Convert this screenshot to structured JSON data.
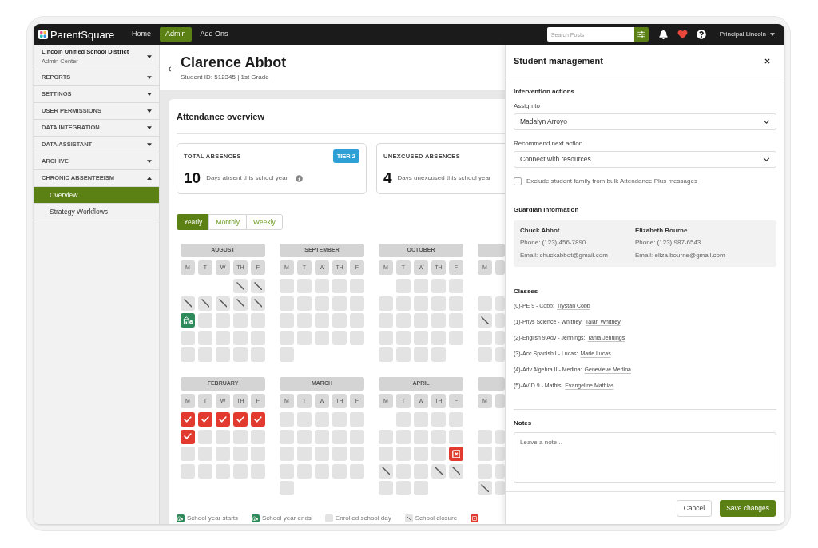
{
  "top_bar": {
    "logo": "ParentSquare",
    "nav": [
      {
        "label": "Home",
        "selected": false
      },
      {
        "label": "Admin",
        "selected": true
      },
      {
        "label": "Add Ons",
        "selected": false
      }
    ],
    "search": {
      "placeholder": "Search Posts"
    },
    "user": "Principal Lincoln"
  },
  "sidebar": {
    "org": {
      "name": "Lincoln Unified School District",
      "subtitle": "Admin Center"
    },
    "sections": [
      {
        "label": "REPORTS",
        "expanded": false
      },
      {
        "label": "SETTINGS",
        "expanded": false
      },
      {
        "label": "USER PERMISSIONS",
        "expanded": false
      },
      {
        "label": "DATA INTEGRATION",
        "expanded": false
      },
      {
        "label": "DATA ASSISTANT",
        "expanded": false
      },
      {
        "label": "ARCHIVE",
        "expanded": false
      },
      {
        "label": "CHRONIC ABSENTEEISM",
        "expanded": true,
        "children": [
          {
            "label": "Overview",
            "selected": true
          },
          {
            "label": "Strategy Workflows",
            "selected": false
          }
        ]
      }
    ]
  },
  "student": {
    "name": "Clarence Abbot",
    "subtitle": "Student ID: 512345 | 1st Grade"
  },
  "attendance": {
    "title": "Attendance overview",
    "stats": [
      {
        "label": "TOTAL ABSENCES",
        "badge": "TIER 2",
        "value": "10",
        "caption": "Days absent this school year",
        "info": true
      },
      {
        "label": "UNEXCUSED ABSENCES",
        "value": "4",
        "caption": "Days unexcused this school year"
      }
    ],
    "views": [
      {
        "label": "Yearly",
        "selected": true
      },
      {
        "label": "Monthly",
        "selected": false
      },
      {
        "label": "Weekly",
        "selected": false
      }
    ],
    "months": [
      {
        "name": "AUGUST",
        "weekdays": [
          "M",
          "T",
          "W",
          "TH",
          "F"
        ],
        "weeks": [
          [
            {
              "kind": "blank"
            },
            {
              "kind": "blank"
            },
            {
              "kind": "blank"
            },
            {
              "kind": "closure"
            },
            {
              "kind": "closure"
            }
          ],
          [
            {
              "kind": "closure"
            },
            {
              "kind": "closure"
            },
            {
              "kind": "closure"
            },
            {
              "kind": "closure"
            },
            {
              "kind": "closure"
            }
          ],
          [
            {
              "kind": "start"
            },
            {
              "kind": "day"
            },
            {
              "kind": "day"
            },
            {
              "kind": "day"
            },
            {
              "kind": "day"
            }
          ],
          [
            {
              "kind": "day"
            },
            {
              "kind": "day"
            },
            {
              "kind": "day"
            },
            {
              "kind": "day"
            },
            {
              "kind": "day"
            }
          ],
          [
            {
              "kind": "day"
            },
            {
              "kind": "day"
            },
            {
              "kind": "day"
            },
            {
              "kind": "day"
            },
            {
              "kind": "day"
            }
          ]
        ]
      },
      {
        "name": "SEPTEMBER",
        "weekdays": [
          "M",
          "T",
          "W",
          "TH",
          "F"
        ],
        "weeks": [
          [
            {
              "kind": "day"
            },
            {
              "kind": "day"
            },
            {
              "kind": "day"
            },
            {
              "kind": "day"
            },
            {
              "kind": "day"
            }
          ],
          [
            {
              "kind": "day"
            },
            {
              "kind": "day"
            },
            {
              "kind": "day"
            },
            {
              "kind": "day"
            },
            {
              "kind": "day"
            }
          ],
          [
            {
              "kind": "day"
            },
            {
              "kind": "day"
            },
            {
              "kind": "day"
            },
            {
              "kind": "day"
            },
            {
              "kind": "day"
            }
          ],
          [
            {
              "kind": "day"
            },
            {
              "kind": "day"
            },
            {
              "kind": "day"
            },
            {
              "kind": "day"
            },
            {
              "kind": "day"
            }
          ],
          [
            {
              "kind": "day"
            }
          ]
        ]
      },
      {
        "name": "OCTOBER",
        "weekdays": [
          "M",
          "T",
          "W",
          "TH",
          "F"
        ],
        "weeks": [
          [
            {
              "kind": "blank"
            },
            {
              "kind": "day"
            },
            {
              "kind": "day"
            },
            {
              "kind": "day"
            },
            {
              "kind": "day"
            }
          ],
          [
            {
              "kind": "day"
            },
            {
              "kind": "day"
            },
            {
              "kind": "day"
            },
            {
              "kind": "day"
            },
            {
              "kind": "day"
            }
          ],
          [
            {
              "kind": "day"
            },
            {
              "kind": "day"
            },
            {
              "kind": "day"
            },
            {
              "kind": "day"
            },
            {
              "kind": "day"
            }
          ],
          [
            {
              "kind": "day"
            },
            {
              "kind": "day"
            },
            {
              "kind": "day"
            },
            {
              "kind": "day"
            },
            {
              "kind": "day"
            }
          ],
          [
            {
              "kind": "day"
            },
            {
              "kind": "day"
            },
            {
              "kind": "day"
            },
            {
              "kind": "day"
            }
          ]
        ]
      },
      {
        "weekdays": [
          "M"
        ],
        "weeks": [
          [
            {
              "kind": "blank"
            },
            {
              "kind": "blank"
            }
          ],
          [
            {
              "kind": "day"
            },
            {
              "kind": "day"
            }
          ],
          [
            {
              "kind": "closure"
            },
            {
              "kind": "day"
            }
          ],
          [
            {
              "kind": "day"
            },
            {
              "kind": "day"
            }
          ],
          [
            {
              "kind": "day"
            },
            {
              "kind": "day"
            }
          ]
        ]
      },
      {
        "name": "FEBRUARY",
        "weekdays": [
          "M",
          "T",
          "W",
          "TH",
          "F"
        ],
        "weeks": [
          [
            {
              "kind": "absent"
            },
            {
              "kind": "absent"
            },
            {
              "kind": "absent"
            },
            {
              "kind": "absent"
            },
            {
              "kind": "absent"
            }
          ],
          [
            {
              "kind": "absent"
            },
            {
              "kind": "day"
            },
            {
              "kind": "day"
            },
            {
              "kind": "day"
            },
            {
              "kind": "day"
            }
          ],
          [
            {
              "kind": "day"
            },
            {
              "kind": "day"
            },
            {
              "kind": "day"
            },
            {
              "kind": "day"
            },
            {
              "kind": "day"
            }
          ],
          [
            {
              "kind": "day"
            },
            {
              "kind": "day"
            },
            {
              "kind": "day"
            },
            {
              "kind": "day"
            },
            {
              "kind": "day"
            }
          ]
        ]
      },
      {
        "name": "MARCH",
        "weekdays": [
          "M",
          "T",
          "W",
          "TH",
          "F"
        ],
        "weeks": [
          [
            {
              "kind": "day"
            },
            {
              "kind": "day"
            },
            {
              "kind": "day"
            },
            {
              "kind": "day"
            },
            {
              "kind": "day"
            }
          ],
          [
            {
              "kind": "day"
            },
            {
              "kind": "day"
            },
            {
              "kind": "day"
            },
            {
              "kind": "day"
            },
            {
              "kind": "day"
            }
          ],
          [
            {
              "kind": "day"
            },
            {
              "kind": "day"
            },
            {
              "kind": "day"
            },
            {
              "kind": "day"
            },
            {
              "kind": "day"
            }
          ],
          [
            {
              "kind": "day"
            },
            {
              "kind": "day"
            },
            {
              "kind": "day"
            },
            {
              "kind": "day"
            },
            {
              "kind": "day"
            }
          ],
          [
            {
              "kind": "day"
            }
          ]
        ]
      },
      {
        "name": "APRIL",
        "weekdays": [
          "M",
          "T",
          "W",
          "TH",
          "F"
        ],
        "weeks": [
          [
            {
              "kind": "blank"
            },
            {
              "kind": "day"
            },
            {
              "kind": "day"
            },
            {
              "kind": "day"
            },
            {
              "kind": "day"
            }
          ],
          [
            {
              "kind": "day"
            },
            {
              "kind": "day"
            },
            {
              "kind": "day"
            },
            {
              "kind": "day"
            },
            {
              "kind": "day"
            }
          ],
          [
            {
              "kind": "day"
            },
            {
              "kind": "day"
            },
            {
              "kind": "day"
            },
            {
              "kind": "day"
            },
            {
              "kind": "unexcused"
            }
          ],
          [
            {
              "kind": "closure"
            },
            {
              "kind": "day"
            },
            {
              "kind": "day"
            },
            {
              "kind": "closure"
            },
            {
              "kind": "closure"
            }
          ],
          [
            {
              "kind": "day"
            },
            {
              "kind": "day"
            },
            {
              "kind": "day"
            }
          ]
        ]
      },
      {
        "weekdays": [
          "M"
        ],
        "weeks": [
          [
            {
              "kind": "blank"
            },
            {
              "kind": "blank"
            }
          ],
          [
            {
              "kind": "day"
            },
            {
              "kind": "day"
            }
          ],
          [
            {
              "kind": "day"
            },
            {
              "kind": "day"
            }
          ],
          [
            {
              "kind": "day"
            },
            {
              "kind": "day"
            }
          ],
          [
            {
              "kind": "closure"
            },
            {
              "kind": "day"
            }
          ]
        ]
      }
    ],
    "legend": [
      {
        "kind": "start",
        "label": "School year starts"
      },
      {
        "kind": "end",
        "label": "School year ends"
      },
      {
        "kind": "day",
        "label": "Enrolled school day"
      },
      {
        "kind": "closure",
        "label": "School closure"
      },
      {
        "kind": "unexcused"
      }
    ]
  },
  "panel": {
    "title": "Student management",
    "intervention": {
      "heading": "Intervention actions",
      "fields": [
        {
          "label": "Assign to",
          "value": "Madalyn Arroyo"
        },
        {
          "label": "Recommend next action",
          "value": "Connect with resources"
        }
      ],
      "exclude": {
        "label": "Exclude student family from bulk Attendance Plus messages",
        "checked": false
      }
    },
    "guardians": {
      "heading": "Guardian information",
      "people": [
        {
          "name": "Chuck Abbot",
          "phone": "Phone: (123) 456-7890",
          "email": "Email: chuckabbot@gmail.com"
        },
        {
          "name": "Elizabeth Bourne",
          "phone": "Phone: (123) 987-6543",
          "email": "Email: eliza.bourne@gmail.com"
        }
      ]
    },
    "classes": {
      "heading": "Classes",
      "items": [
        {
          "course": "(0)-PE 9 - Cobb:",
          "teacher": "Trystan Cobb"
        },
        {
          "course": "(1)-Phys Science - Whitney:",
          "teacher": "Talan Whitney"
        },
        {
          "course": "(2)-English 9 Adv - Jennings:",
          "teacher": "Tania Jennings"
        },
        {
          "course": "(3)-Acc Spanish I - Lucas:",
          "teacher": "Marie Lucas"
        },
        {
          "course": "(4)-Adv Algebra II - Medina:",
          "teacher": "Genevieve Medina"
        },
        {
          "course": "(5)-AVID 9 - Mathis:",
          "teacher": "Evangeline Mathias"
        }
      ]
    },
    "notes": {
      "heading": "Notes",
      "placeholder": "Leave a note..."
    },
    "buttons": [
      {
        "label": "Cancel",
        "kind": "secondary"
      },
      {
        "label": "Save changes",
        "kind": "primary"
      }
    ]
  }
}
